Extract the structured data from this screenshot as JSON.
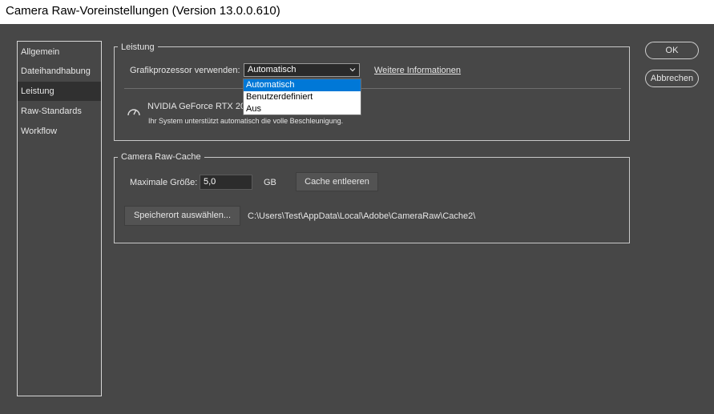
{
  "window": {
    "title": "Camera Raw-Voreinstellungen  (Version 13.0.0.610)"
  },
  "sidebar": {
    "items": [
      {
        "label": "Allgemein"
      },
      {
        "label": "Dateihandhabung"
      },
      {
        "label": "Leistung",
        "selected": true
      },
      {
        "label": "Raw-Standards"
      },
      {
        "label": "Workflow"
      }
    ]
  },
  "performance": {
    "legend": "Leistung",
    "gpu_label": "Grafikprozessor verwenden:",
    "gpu_value": "Automatisch",
    "more_info_link": "Weitere Informationen",
    "gpu_options": [
      "Automatisch",
      "Benutzerdefiniert",
      "Aus"
    ],
    "gpu_name": "NVIDIA GeForce RTX 206",
    "gpu_status": "Ihr System unterstützt automatisch die volle Beschleunigung."
  },
  "cache": {
    "legend": "Camera Raw-Cache",
    "max_size_label": "Maximale Größe:",
    "max_size_value": "5,0",
    "unit": "GB",
    "purge_button": "Cache entleeren",
    "location_button": "Speicherort auswählen...",
    "location_path": "C:\\Users\\Test\\AppData\\Local\\Adobe\\CameraRaw\\Cache2\\"
  },
  "buttons": {
    "ok": "OK",
    "cancel": "Abbrechen"
  },
  "colors": {
    "dialog_bg": "#474747",
    "selection": "#0078d7",
    "sidebar_active": "#303030"
  },
  "icons": {
    "gpu": "speedometer-icon",
    "dropdown": "chevron-down-icon"
  }
}
